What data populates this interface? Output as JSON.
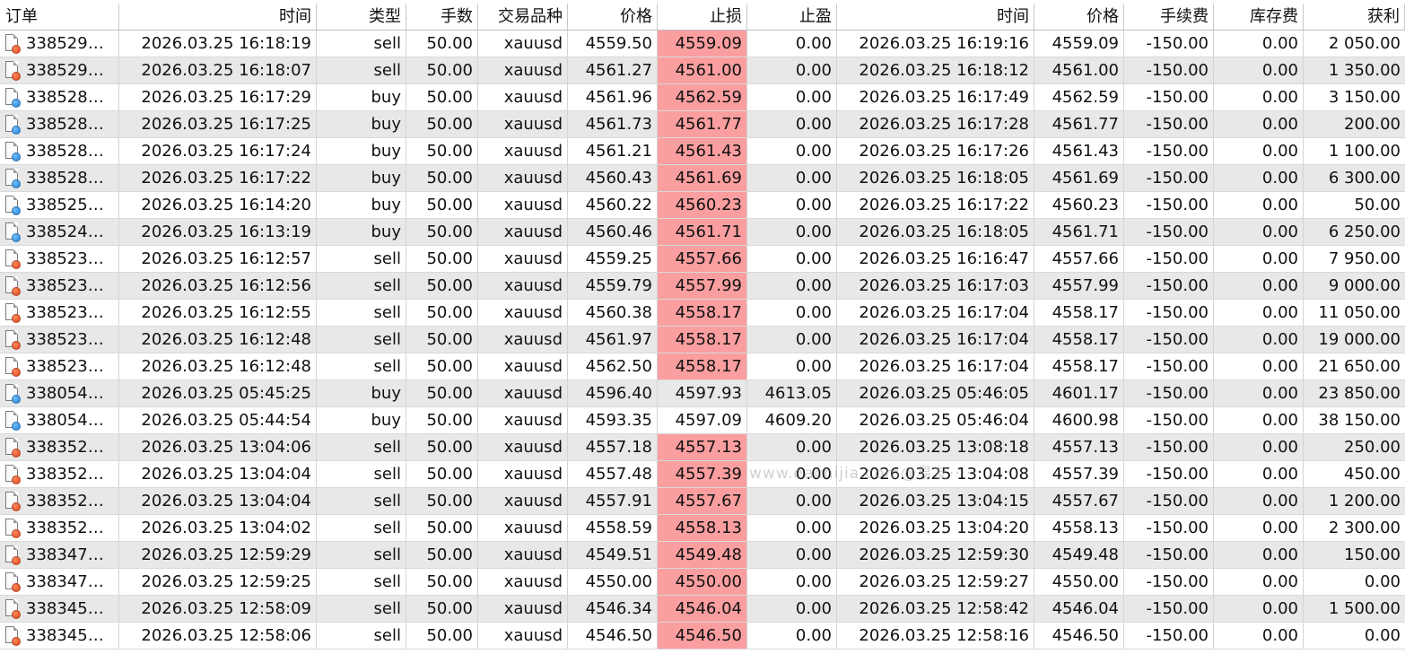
{
  "headers": [
    "订单",
    "时间",
    "类型",
    "手数",
    "交易品种",
    "价格",
    "止损",
    "止盈",
    "时间",
    "价格",
    "手续费",
    "库存费",
    "获利"
  ],
  "colors": {
    "sl_highlight": "#fa9ea0",
    "alt_row": "#e8e8e8",
    "sell_icon": "#e0411a",
    "buy_icon": "#1f7fd6"
  },
  "watermark": "www.eachijia.com@易友·····",
  "rows": [
    {
      "order": "338529…",
      "open_time": "2026.03.25 16:18:19",
      "type": "sell",
      "volume": "50.00",
      "symbol": "xauusd",
      "open_price": "4559.50",
      "sl": "4559.09",
      "tp": "0.00",
      "close_time": "2026.03.25 16:19:16",
      "close_price": "4559.09",
      "commission": "-150.00",
      "swap": "0.00",
      "profit": "2 050.00",
      "sl_hit": true
    },
    {
      "order": "338529…",
      "open_time": "2026.03.25 16:18:07",
      "type": "sell",
      "volume": "50.00",
      "symbol": "xauusd",
      "open_price": "4561.27",
      "sl": "4561.00",
      "tp": "0.00",
      "close_time": "2026.03.25 16:18:12",
      "close_price": "4561.00",
      "commission": "-150.00",
      "swap": "0.00",
      "profit": "1 350.00",
      "sl_hit": true
    },
    {
      "order": "338528…",
      "open_time": "2026.03.25 16:17:29",
      "type": "buy",
      "volume": "50.00",
      "symbol": "xauusd",
      "open_price": "4561.96",
      "sl": "4562.59",
      "tp": "0.00",
      "close_time": "2026.03.25 16:17:49",
      "close_price": "4562.59",
      "commission": "-150.00",
      "swap": "0.00",
      "profit": "3 150.00",
      "sl_hit": true
    },
    {
      "order": "338528…",
      "open_time": "2026.03.25 16:17:25",
      "type": "buy",
      "volume": "50.00",
      "symbol": "xauusd",
      "open_price": "4561.73",
      "sl": "4561.77",
      "tp": "0.00",
      "close_time": "2026.03.25 16:17:28",
      "close_price": "4561.77",
      "commission": "-150.00",
      "swap": "0.00",
      "profit": "200.00",
      "sl_hit": true
    },
    {
      "order": "338528…",
      "open_time": "2026.03.25 16:17:24",
      "type": "buy",
      "volume": "50.00",
      "symbol": "xauusd",
      "open_price": "4561.21",
      "sl": "4561.43",
      "tp": "0.00",
      "close_time": "2026.03.25 16:17:26",
      "close_price": "4561.43",
      "commission": "-150.00",
      "swap": "0.00",
      "profit": "1 100.00",
      "sl_hit": true
    },
    {
      "order": "338528…",
      "open_time": "2026.03.25 16:17:22",
      "type": "buy",
      "volume": "50.00",
      "symbol": "xauusd",
      "open_price": "4560.43",
      "sl": "4561.69",
      "tp": "0.00",
      "close_time": "2026.03.25 16:18:05",
      "close_price": "4561.69",
      "commission": "-150.00",
      "swap": "0.00",
      "profit": "6 300.00",
      "sl_hit": true
    },
    {
      "order": "338525…",
      "open_time": "2026.03.25 16:14:20",
      "type": "buy",
      "volume": "50.00",
      "symbol": "xauusd",
      "open_price": "4560.22",
      "sl": "4560.23",
      "tp": "0.00",
      "close_time": "2026.03.25 16:17:22",
      "close_price": "4560.23",
      "commission": "-150.00",
      "swap": "0.00",
      "profit": "50.00",
      "sl_hit": true
    },
    {
      "order": "338524…",
      "open_time": "2026.03.25 16:13:19",
      "type": "buy",
      "volume": "50.00",
      "symbol": "xauusd",
      "open_price": "4560.46",
      "sl": "4561.71",
      "tp": "0.00",
      "close_time": "2026.03.25 16:18:05",
      "close_price": "4561.71",
      "commission": "-150.00",
      "swap": "0.00",
      "profit": "6 250.00",
      "sl_hit": true
    },
    {
      "order": "338523…",
      "open_time": "2026.03.25 16:12:57",
      "type": "sell",
      "volume": "50.00",
      "symbol": "xauusd",
      "open_price": "4559.25",
      "sl": "4557.66",
      "tp": "0.00",
      "close_time": "2026.03.25 16:16:47",
      "close_price": "4557.66",
      "commission": "-150.00",
      "swap": "0.00",
      "profit": "7 950.00",
      "sl_hit": true
    },
    {
      "order": "338523…",
      "open_time": "2026.03.25 16:12:56",
      "type": "sell",
      "volume": "50.00",
      "symbol": "xauusd",
      "open_price": "4559.79",
      "sl": "4557.99",
      "tp": "0.00",
      "close_time": "2026.03.25 16:17:03",
      "close_price": "4557.99",
      "commission": "-150.00",
      "swap": "0.00",
      "profit": "9 000.00",
      "sl_hit": true
    },
    {
      "order": "338523…",
      "open_time": "2026.03.25 16:12:55",
      "type": "sell",
      "volume": "50.00",
      "symbol": "xauusd",
      "open_price": "4560.38",
      "sl": "4558.17",
      "tp": "0.00",
      "close_time": "2026.03.25 16:17:04",
      "close_price": "4558.17",
      "commission": "-150.00",
      "swap": "0.00",
      "profit": "11 050.00",
      "sl_hit": true
    },
    {
      "order": "338523…",
      "open_time": "2026.03.25 16:12:48",
      "type": "sell",
      "volume": "50.00",
      "symbol": "xauusd",
      "open_price": "4561.97",
      "sl": "4558.17",
      "tp": "0.00",
      "close_time": "2026.03.25 16:17:04",
      "close_price": "4558.17",
      "commission": "-150.00",
      "swap": "0.00",
      "profit": "19 000.00",
      "sl_hit": true
    },
    {
      "order": "338523…",
      "open_time": "2026.03.25 16:12:48",
      "type": "sell",
      "volume": "50.00",
      "symbol": "xauusd",
      "open_price": "4562.50",
      "sl": "4558.17",
      "tp": "0.00",
      "close_time": "2026.03.25 16:17:04",
      "close_price": "4558.17",
      "commission": "-150.00",
      "swap": "0.00",
      "profit": "21 650.00",
      "sl_hit": true
    },
    {
      "order": "338054…",
      "open_time": "2026.03.25 05:45:25",
      "type": "buy",
      "volume": "50.00",
      "symbol": "xauusd",
      "open_price": "4596.40",
      "sl": "4597.93",
      "tp": "4613.05",
      "close_time": "2026.03.25 05:46:05",
      "close_price": "4601.17",
      "commission": "-150.00",
      "swap": "0.00",
      "profit": "23 850.00",
      "sl_hit": false
    },
    {
      "order": "338054…",
      "open_time": "2026.03.25 05:44:54",
      "type": "buy",
      "volume": "50.00",
      "symbol": "xauusd",
      "open_price": "4593.35",
      "sl": "4597.09",
      "tp": "4609.20",
      "close_time": "2026.03.25 05:46:04",
      "close_price": "4600.98",
      "commission": "-150.00",
      "swap": "0.00",
      "profit": "38 150.00",
      "sl_hit": false
    },
    {
      "order": "338352…",
      "open_time": "2026.03.25 13:04:06",
      "type": "sell",
      "volume": "50.00",
      "symbol": "xauusd",
      "open_price": "4557.18",
      "sl": "4557.13",
      "tp": "0.00",
      "close_time": "2026.03.25 13:08:18",
      "close_price": "4557.13",
      "commission": "-150.00",
      "swap": "0.00",
      "profit": "250.00",
      "sl_hit": true
    },
    {
      "order": "338352…",
      "open_time": "2026.03.25 13:04:04",
      "type": "sell",
      "volume": "50.00",
      "symbol": "xauusd",
      "open_price": "4557.48",
      "sl": "4557.39",
      "tp": "0.00",
      "close_time": "2026.03.25 13:04:08",
      "close_price": "4557.39",
      "commission": "-150.00",
      "swap": "0.00",
      "profit": "450.00",
      "sl_hit": true
    },
    {
      "order": "338352…",
      "open_time": "2026.03.25 13:04:04",
      "type": "sell",
      "volume": "50.00",
      "symbol": "xauusd",
      "open_price": "4557.91",
      "sl": "4557.67",
      "tp": "0.00",
      "close_time": "2026.03.25 13:04:15",
      "close_price": "4557.67",
      "commission": "-150.00",
      "swap": "0.00",
      "profit": "1 200.00",
      "sl_hit": true
    },
    {
      "order": "338352…",
      "open_time": "2026.03.25 13:04:02",
      "type": "sell",
      "volume": "50.00",
      "symbol": "xauusd",
      "open_price": "4558.59",
      "sl": "4558.13",
      "tp": "0.00",
      "close_time": "2026.03.25 13:04:20",
      "close_price": "4558.13",
      "commission": "-150.00",
      "swap": "0.00",
      "profit": "2 300.00",
      "sl_hit": true
    },
    {
      "order": "338347…",
      "open_time": "2026.03.25 12:59:29",
      "type": "sell",
      "volume": "50.00",
      "symbol": "xauusd",
      "open_price": "4549.51",
      "sl": "4549.48",
      "tp": "0.00",
      "close_time": "2026.03.25 12:59:30",
      "close_price": "4549.48",
      "commission": "-150.00",
      "swap": "0.00",
      "profit": "150.00",
      "sl_hit": true
    },
    {
      "order": "338347…",
      "open_time": "2026.03.25 12:59:25",
      "type": "sell",
      "volume": "50.00",
      "symbol": "xauusd",
      "open_price": "4550.00",
      "sl": "4550.00",
      "tp": "0.00",
      "close_time": "2026.03.25 12:59:27",
      "close_price": "4550.00",
      "commission": "-150.00",
      "swap": "0.00",
      "profit": "0.00",
      "sl_hit": true
    },
    {
      "order": "338345…",
      "open_time": "2026.03.25 12:58:09",
      "type": "sell",
      "volume": "50.00",
      "symbol": "xauusd",
      "open_price": "4546.34",
      "sl": "4546.04",
      "tp": "0.00",
      "close_time": "2026.03.25 12:58:42",
      "close_price": "4546.04",
      "commission": "-150.00",
      "swap": "0.00",
      "profit": "1 500.00",
      "sl_hit": true
    },
    {
      "order": "338345…",
      "open_time": "2026.03.25 12:58:06",
      "type": "sell",
      "volume": "50.00",
      "symbol": "xauusd",
      "open_price": "4546.50",
      "sl": "4546.50",
      "tp": "0.00",
      "close_time": "2026.03.25 12:58:16",
      "close_price": "4546.50",
      "commission": "-150.00",
      "swap": "0.00",
      "profit": "0.00",
      "sl_hit": true
    }
  ]
}
